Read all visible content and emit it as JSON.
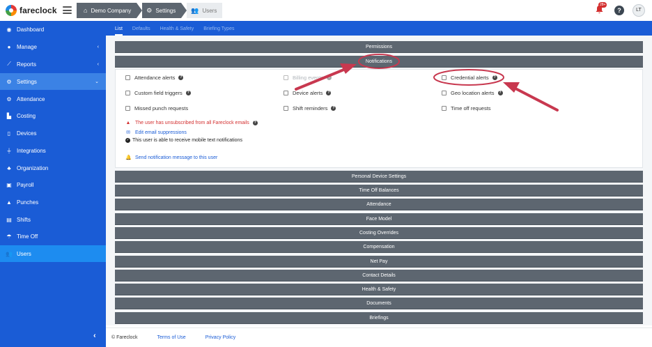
{
  "app": {
    "name": "fareclock"
  },
  "breadcrumbs": [
    "Demo Company",
    "Settings",
    "Users"
  ],
  "header": {
    "notifications_badge": "28+",
    "help_label": "?",
    "avatar_initials": "LT"
  },
  "sidebar": {
    "items": [
      {
        "label": "Dashboard",
        "icon": "dashboard-icon"
      },
      {
        "label": "Manage",
        "icon": "person-icon",
        "chevron": "‹"
      },
      {
        "label": "Reports",
        "icon": "chart-icon",
        "chevron": "‹"
      },
      {
        "label": "Settings",
        "icon": "gear-icon",
        "chevron": "⌄"
      },
      {
        "label": "Attendance",
        "icon": "gear-icon"
      },
      {
        "label": "Costing",
        "icon": "bar-chart-icon"
      },
      {
        "label": "Devices",
        "icon": "tablet-icon"
      },
      {
        "label": "Integrations",
        "icon": "plug-icon"
      },
      {
        "label": "Organization",
        "icon": "org-chart-icon"
      },
      {
        "label": "Payroll",
        "icon": "money-icon"
      },
      {
        "label": "Punches",
        "icon": "stamp-icon"
      },
      {
        "label": "Shifts",
        "icon": "briefcase-icon"
      },
      {
        "label": "Time Off",
        "icon": "beach-icon"
      },
      {
        "label": "Users",
        "icon": "users-icon"
      }
    ],
    "collapse_label": "‹"
  },
  "tabs": [
    "List",
    "Defaults",
    "Health & Safety",
    "Briefing Types"
  ],
  "panels": {
    "permissions": "Permissions",
    "notifications": "Notifications",
    "after": [
      "Personal Device Settings",
      "Time Off Balances",
      "Attendance",
      "Face Model",
      "Costing Overrides",
      "Compensation",
      "Net Pay",
      "Contact Details",
      "Health & Safety",
      "Documents",
      "Briefings"
    ]
  },
  "notifications": {
    "checkboxes": [
      {
        "label": "Attendance alerts",
        "help": true,
        "disabled": false
      },
      {
        "label": "Billing events",
        "help": true,
        "disabled": true
      },
      {
        "label": "Credential alerts",
        "help": true,
        "disabled": false
      },
      {
        "label": "Custom field triggers",
        "help": true,
        "disabled": false
      },
      {
        "label": "Device alerts",
        "help": true,
        "disabled": false
      },
      {
        "label": "Geo location alerts",
        "help": true,
        "disabled": false
      },
      {
        "label": "Missed punch requests",
        "help": false,
        "disabled": false
      },
      {
        "label": "Shift reminders",
        "help": true,
        "disabled": false
      },
      {
        "label": "Time off requests",
        "help": false,
        "disabled": false
      }
    ],
    "unsubscribed_warning": "The user has unsubscribed from all Fareclock emails",
    "edit_suppressions": "Edit email suppressions",
    "mobile_text_ok": "This user is able to receive mobile text notifications",
    "send_message": "Send notification message to this user"
  },
  "footer": {
    "copyright": "© Fareclock",
    "terms": "Terms of Use",
    "privacy": "Privacy Policy"
  },
  "colors": {
    "sidebar": "#1a5cd6",
    "sidebar_active": "#1d8cf0",
    "panel": "#5d6670",
    "annotation": "#c8384f"
  }
}
